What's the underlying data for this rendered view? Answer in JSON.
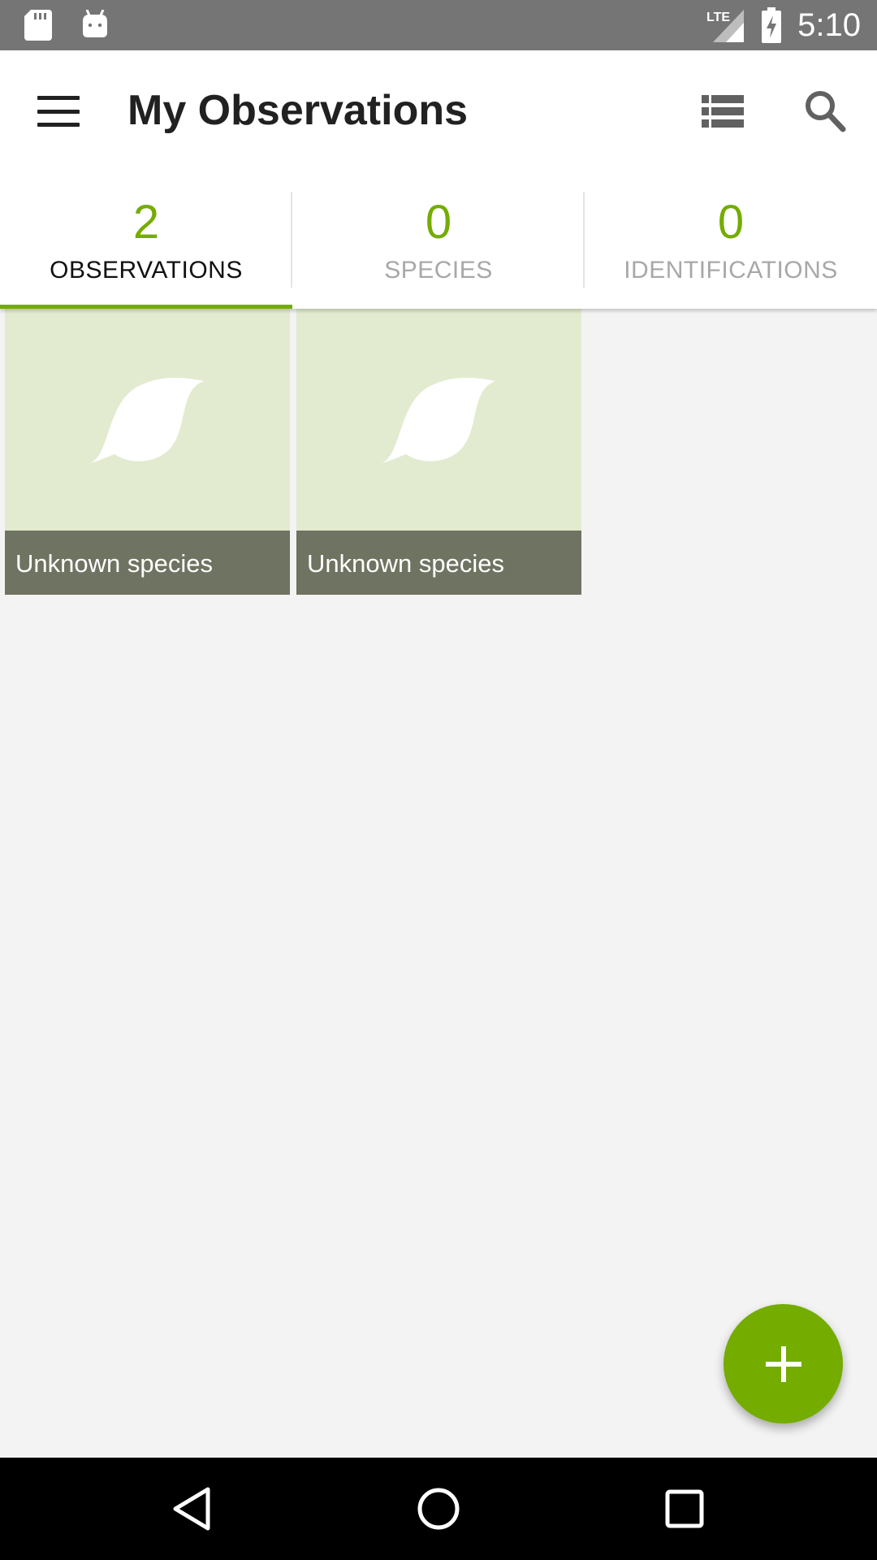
{
  "status_bar": {
    "time": "5:10",
    "network_label": "LTE",
    "icons": [
      "sd-card-icon",
      "android-icon",
      "lte-signal-icon",
      "battery-charging-icon"
    ]
  },
  "app_bar": {
    "title": "My Observations",
    "icons": [
      "menu-icon",
      "list-view-icon",
      "search-icon"
    ]
  },
  "tabs": [
    {
      "count": "2",
      "label": "OBSERVATIONS",
      "active": true
    },
    {
      "count": "0",
      "label": "SPECIES",
      "active": false
    },
    {
      "count": "0",
      "label": "IDENTIFICATIONS",
      "active": false
    }
  ],
  "observations": [
    {
      "caption": "Unknown species",
      "icon": "leaf-icon"
    },
    {
      "caption": "Unknown species",
      "icon": "leaf-icon"
    }
  ],
  "fab": {
    "icon": "plus-icon"
  },
  "nav_bar": {
    "icons": [
      "back-icon",
      "home-icon",
      "recents-icon"
    ]
  },
  "colors": {
    "accent": "#74ac00",
    "status_bar": "#757575",
    "card_background": "#e2ebcf",
    "card_caption": "#6f7361",
    "page_background": "#f3f3f3"
  }
}
